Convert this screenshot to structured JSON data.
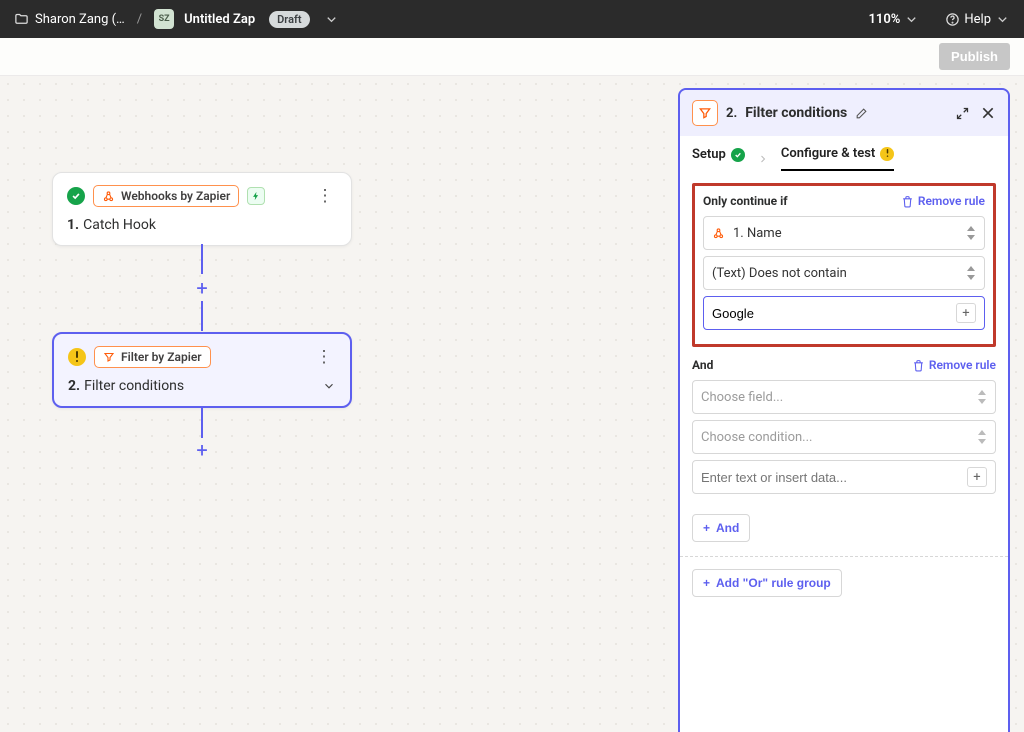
{
  "header": {
    "folder_name": "Sharon Zang (…",
    "avatar_initials": "SZ",
    "zap_title": "Untitled Zap",
    "draft_label": "Draft",
    "zoom": "110%",
    "help_label": "Help"
  },
  "subbar": {
    "publish_label": "Publish"
  },
  "canvas": {
    "step1": {
      "app_name": "Webhooks by Zapier",
      "number": "1.",
      "title": "Catch Hook"
    },
    "step2": {
      "app_name": "Filter by Zapier",
      "number": "2.",
      "title": "Filter conditions"
    }
  },
  "panel": {
    "number": "2.",
    "title": "Filter conditions",
    "tab_setup": "Setup",
    "tab_configure": "Configure & test",
    "rule1": {
      "heading": "Only continue if",
      "remove_label": "Remove rule",
      "field_label": "1. Name",
      "condition_label": "(Text) Does not contain",
      "value": "Google"
    },
    "rule2": {
      "heading": "And",
      "remove_label": "Remove rule",
      "field_placeholder": "Choose field...",
      "condition_placeholder": "Choose condition...",
      "value_placeholder": "Enter text or insert data..."
    },
    "and_button": "And",
    "or_button": "Add \"Or\" rule group"
  }
}
